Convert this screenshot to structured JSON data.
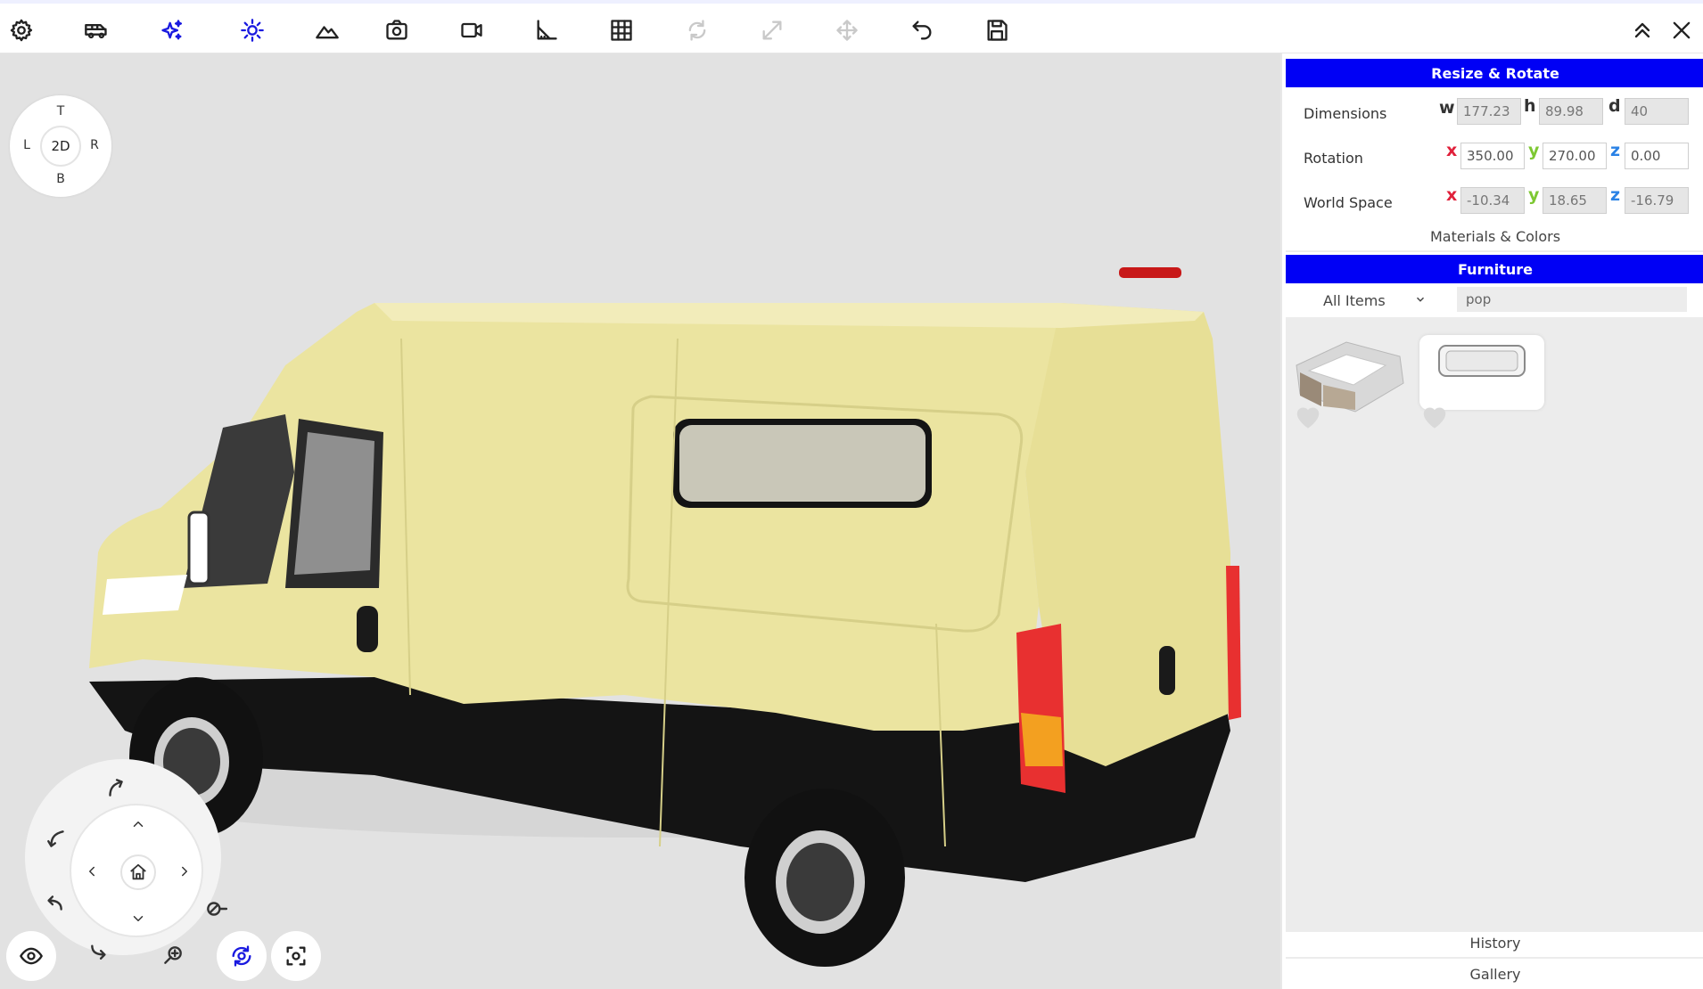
{
  "toolbar": {
    "tools": [
      {
        "icon": "gear-icon",
        "label": "settings"
      },
      {
        "icon": "van-icon",
        "label": "vehicle"
      },
      {
        "icon": "sparkles-icon",
        "label": "effects"
      },
      {
        "icon": "sun-icon",
        "label": "lighting"
      },
      {
        "icon": "mountains-icon",
        "label": "environment"
      },
      {
        "icon": "camera-icon",
        "label": "screenshot"
      },
      {
        "icon": "video-icon",
        "label": "record"
      },
      {
        "icon": "ruler-angle-icon",
        "label": "measure"
      },
      {
        "icon": "grid-icon",
        "label": "grid"
      },
      {
        "icon": "rotate-icon",
        "label": "rotate"
      },
      {
        "icon": "resize-icon",
        "label": "scale"
      },
      {
        "icon": "move-icon",
        "label": "move"
      },
      {
        "icon": "undo-icon",
        "label": "undo"
      },
      {
        "icon": "save-icon",
        "label": "save"
      }
    ],
    "right": [
      {
        "icon": "collapse-icon"
      },
      {
        "icon": "close-icon"
      }
    ]
  },
  "compass": {
    "top": "T",
    "left": "L",
    "right": "R",
    "bottom": "B",
    "center": "2D"
  },
  "panel": {
    "resize_rotate": {
      "title": "Resize & Rotate",
      "dimensions": {
        "label": "Dimensions",
        "w_axis": "w",
        "h_axis": "h",
        "d_axis": "d",
        "w": "177.23",
        "h": "89.98",
        "d": "40"
      },
      "rotation": {
        "label": "Rotation",
        "x_axis": "x",
        "y_axis": "y",
        "z_axis": "z",
        "x": "350.00",
        "y": "270.00",
        "z": "0.00"
      },
      "world_space": {
        "label": "World Space",
        "x_axis": "x",
        "y_axis": "y",
        "z_axis": "z",
        "x": "-10.34",
        "y": "18.65",
        "z": "-16.79"
      }
    },
    "materials_label": "Materials & Colors",
    "furniture": {
      "title": "Furniture",
      "filter_selected": "All Items",
      "search_value": "pop"
    },
    "history_label": "History",
    "gallery_label": "Gallery"
  },
  "colors": {
    "accent_blue": "#0000f5",
    "van_body": "#ebe4a0",
    "axis_x": "#e0203a",
    "axis_y": "#7dc832",
    "axis_z": "#2a82e6"
  }
}
